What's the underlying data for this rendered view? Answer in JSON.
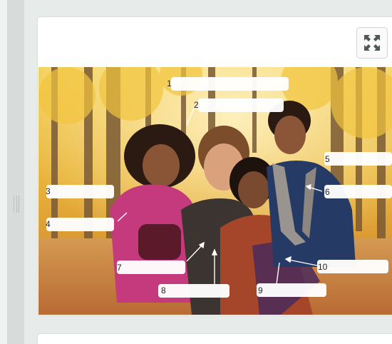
{
  "toolbar": {
    "fullscreen_icon": "expand-icon"
  },
  "photo": {
    "description_icon": "family-photo",
    "labels": [
      {
        "number": "1"
      },
      {
        "number": "2"
      },
      {
        "number": "3"
      },
      {
        "number": "4"
      },
      {
        "number": "5"
      },
      {
        "number": "6"
      },
      {
        "number": "7"
      },
      {
        "number": "8"
      },
      {
        "number": "9"
      },
      {
        "number": "10"
      }
    ]
  },
  "colors": {
    "page_bg": "#e7ecea",
    "splitter": "#d7dbd9",
    "card": "#ffffff",
    "label_box": "#ffffff"
  }
}
